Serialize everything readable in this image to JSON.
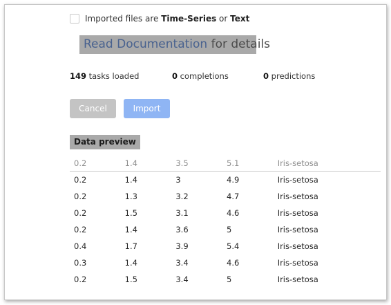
{
  "import_options": {
    "timeseries_text_prefix": "Imported files are ",
    "timeseries_label": "Time-Series",
    "or_label": " or ",
    "text_label": "Text",
    "doc_link_label": "Read Documentation",
    "doc_suffix": " for details"
  },
  "stats": {
    "tasks_count": "149",
    "tasks_label": " tasks loaded",
    "completions_count": "0",
    "completions_label": " completions",
    "predictions_count": "0",
    "predictions_label": " predictions"
  },
  "buttons": {
    "cancel_label": "Cancel",
    "import_label": "Import"
  },
  "preview": {
    "title": "Data preview",
    "columns": [
      "0.2",
      "1.4",
      "3.5",
      "5.1",
      "Iris-setosa"
    ],
    "rows": [
      [
        "0.2",
        "1.4",
        "3",
        "4.9",
        "Iris-setosa"
      ],
      [
        "0.2",
        "1.3",
        "3.2",
        "4.7",
        "Iris-setosa"
      ],
      [
        "0.2",
        "1.5",
        "3.1",
        "4.6",
        "Iris-setosa"
      ],
      [
        "0.2",
        "1.4",
        "3.6",
        "5",
        "Iris-setosa"
      ],
      [
        "0.4",
        "1.7",
        "3.9",
        "5.4",
        "Iris-setosa"
      ],
      [
        "0.3",
        "1.4",
        "3.4",
        "4.6",
        "Iris-setosa"
      ],
      [
        "0.2",
        "1.5",
        "3.4",
        "5",
        "Iris-setosa"
      ]
    ]
  },
  "colors": {
    "banner_bg": "#a9a9a9",
    "link": "#49628f",
    "cancel_bg": "#c4c4c4",
    "import_bg": "#8fb5f4"
  }
}
